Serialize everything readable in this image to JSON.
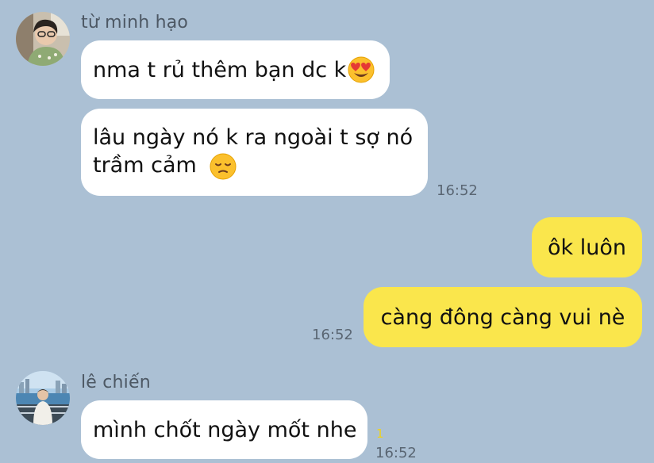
{
  "colors": {
    "background": "#abc0d4",
    "incoming_bubble": "#ffffff",
    "outgoing_bubble": "#fae64c",
    "unread_count": "#efd31b",
    "timestamp": "#5a6673"
  },
  "groups": [
    {
      "sender": "từ minh hạo",
      "avatar": "avatar-photo",
      "messages": [
        {
          "text": "nma t rủ thêm bạn dc k",
          "emoji": "heart-eyes-emoji"
        },
        {
          "line1": "lâu ngày nó k ra ngoài t sợ nó",
          "line2": "trầm cảm",
          "emoji": "pensive-face-emoji"
        }
      ],
      "time": "16:52"
    },
    {
      "sender": "me",
      "messages": [
        {
          "text": "ôk luôn"
        },
        {
          "text": "càng đông càng vui nè"
        }
      ],
      "time": "16:52"
    },
    {
      "sender": "lê chiến",
      "avatar": "avatar-photo",
      "messages": [
        {
          "text": "mình chốt ngày mốt nhe"
        }
      ],
      "unread": "1",
      "time": "16:52"
    }
  ]
}
